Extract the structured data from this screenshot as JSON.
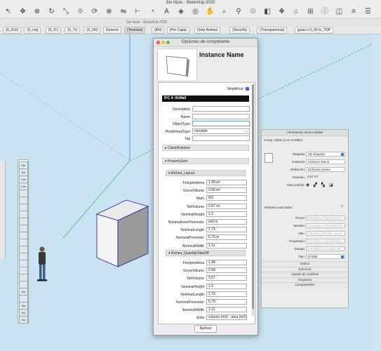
{
  "window": {
    "title": "Sin título - SketchUp 2025",
    "subtitle": "Sin título - SketchUp 2025"
  },
  "toolbar": {
    "icons": [
      "select-icon",
      "move-icon",
      "target-icon",
      "rotate-icon",
      "scale-icon",
      "offset-icon",
      "followme-icon",
      "intersect-icon",
      "flip-icon",
      "tape-icon",
      "protractor-icon",
      "text-icon",
      "paint-icon",
      "orbit-icon",
      "pan-icon",
      "zoom-icon",
      "walk-icon",
      "position-camera-icon",
      "section-icon",
      "components-icon",
      "warehouse-icon",
      "extension-icon",
      "info-icon",
      "styles-icon",
      "layers-icon",
      "outliner-icon"
    ]
  },
  "scenes": [
    "(S_Dch)",
    "(S_Izq)",
    "(S_Fr)",
    "(S_Tr)",
    "(S_N0)",
    "General",
    "(Texturas)",
    "(BN)",
    "(Por Capa)",
    "(Solo Aristas)",
    "(Sencillo)",
    "(Transparencia)",
    "guias n 0_00 m_TOP"
  ],
  "palette": [
    "Ma",
    "Ma",
    "Can",
    "Can",
    "",
    "",
    "",
    "",
    "",
    "",
    "",
    "",
    "",
    "",
    "",
    "",
    "",
    "",
    "Ma",
    "",
    "Ma",
    "Ma",
    "Ma"
  ],
  "component_options": {
    "title": "Opciones de componente",
    "instance_name": "Instance Name",
    "simplify_label": "Simplificar:",
    "ifc_header": "IFC 4: IfcWall",
    "fields": [
      {
        "label": "Description",
        "value": ""
      },
      {
        "label": "Name",
        "value": ""
      },
      {
        "label": "ObjectType",
        "value": ""
      },
      {
        "label": "PredefinedType",
        "value": "movable"
      },
      {
        "label": "Tag",
        "value": ""
      }
    ],
    "sections": {
      "classifications": "Classifications",
      "propertysets": "PropertySets"
    },
    "layout_group": {
      "title": "Riches_Layout",
      "rows": [
        {
          "label": "FootprintArea",
          "value": "1.98 m²"
        },
        {
          "label": "GrossVolume",
          "value": "2.58 m³"
        },
        {
          "label": "Mark",
          "value": "W1"
        },
        {
          "label": "NetVolume",
          "value": "2.57 m³"
        },
        {
          "label": "NominalHeight",
          "value": "1.3"
        },
        {
          "label": "NominalInnerPerimeter",
          "value": "null m"
        },
        {
          "label": "NominalLength",
          "value": "1.79"
        },
        {
          "label": "NominalPerimeter",
          "value": "5.79 m"
        },
        {
          "label": "NominalWidth",
          "value": "1.11"
        }
      ]
    },
    "quantity_group": {
      "title": "Riches_QuantityTakeOff",
      "rows": [
        {
          "label": "FootprintArea",
          "value": "1.98"
        },
        {
          "label": "GrossVolume",
          "value": "2.58"
        },
        {
          "label": "NetVolume",
          "value": "2.57"
        },
        {
          "label": "NominalHeight",
          "value": "1.3"
        },
        {
          "label": "NominalLength",
          "value": "1.79"
        },
        {
          "label": "NominalPerimeter",
          "value": "5.79"
        },
        {
          "label": "NominalWidth",
          "value": "1.11"
        },
        {
          "label": "Units",
          "value": "volume (m3) - area (m2) - longi"
        }
      ]
    },
    "apply_label": "Aplicar"
  },
  "entity_info": {
    "title": "Información de la entidad",
    "summary": "Comp. sólido (1 en modelo)",
    "label_tag": "Etiqueta:",
    "tag_value": "Sin etiqueta",
    "label_instance": "Instancia:",
    "instance_value": "Instance Name",
    "label_definition": "Definición:",
    "definition_value": "Definition Name",
    "label_volume": "Volumen:",
    "volume_value": "2,57 m³",
    "label_swap": "Intercambiar:",
    "advanced": "Atributos avanzados",
    "label_price": "Precio:",
    "price_ph": "Introduzca el precio de l",
    "label_size": "Tamaño:",
    "size_ph": "Introduzca el tamaño de",
    "label_url": "URL:",
    "url_ph": "Introduzca la URL de en",
    "label_owner": "Propietario:",
    "owner_ph": "Introduzca el propietario",
    "label_state": "Estado:",
    "state_ph": "Introduzca el estado de",
    "label_type": "Tipo:",
    "type_value": "IfcWall",
    "tabs": [
      "Estilos",
      "Entornos",
      "Ajustes de sombras",
      "Esquema",
      "Componentes"
    ]
  },
  "colors": {
    "sky": "#c9e3f3",
    "box_edge": "#1a1aa8",
    "axis_green": "#2aa63a",
    "accent_blue": "#2a6be2"
  }
}
